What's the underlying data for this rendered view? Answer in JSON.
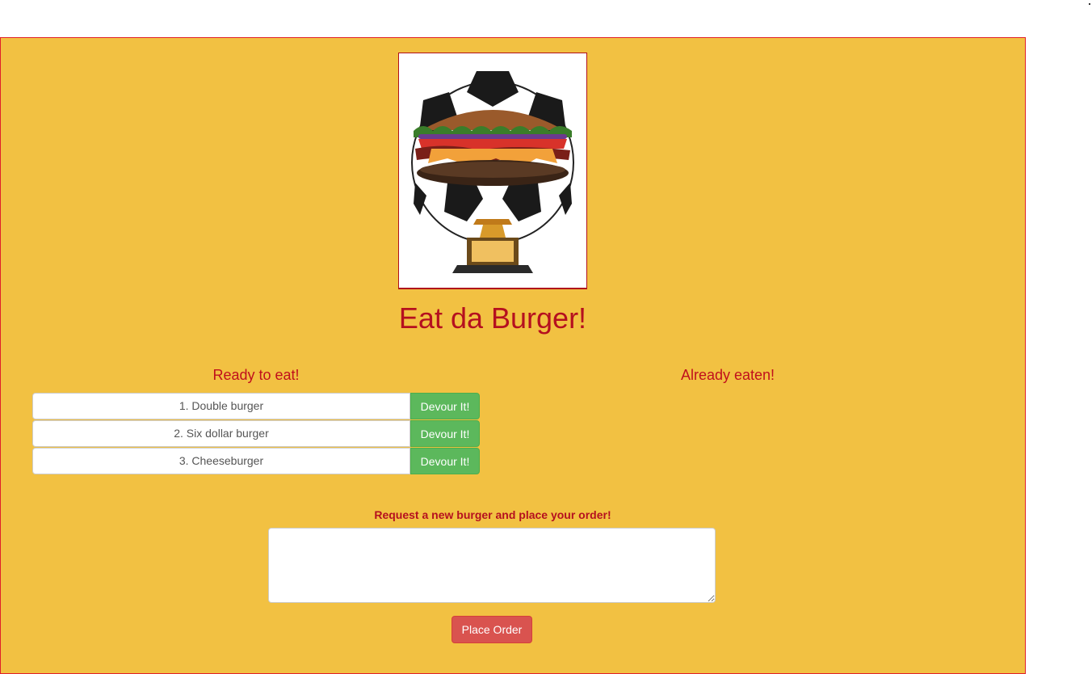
{
  "header": {
    "title": "Eat da Burger!"
  },
  "columns": {
    "ready_heading": "Ready to eat!",
    "eaten_heading": "Already eaten!"
  },
  "burgers": [
    {
      "label": "1. Double burger",
      "action": "Devour It!"
    },
    {
      "label": "2. Six dollar burger",
      "action": "Devour It!"
    },
    {
      "label": "3. Cheeseburger",
      "action": "Devour It!"
    }
  ],
  "eaten_burgers": [],
  "order_form": {
    "label": "Request a new burger and place your order!",
    "value": "",
    "submit_label": "Place Order"
  },
  "logo": {
    "icon": "burger-trophy-logo"
  },
  "colors": {
    "background": "#f2c142",
    "accent_red": "#b5101f",
    "devour_green": "#5cb85c",
    "order_red": "#d9534f"
  }
}
